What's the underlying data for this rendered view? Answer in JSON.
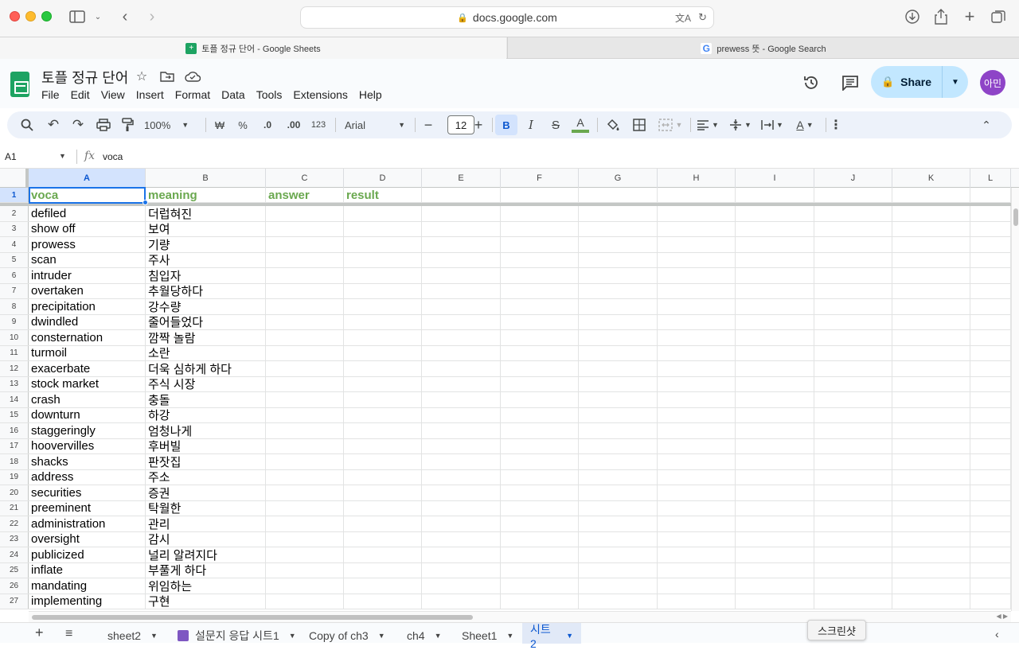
{
  "browser": {
    "url": "docs.google.com",
    "tabs": [
      {
        "title": "토플 정규 단어 - Google Sheets"
      },
      {
        "title": "prewess 뜻 - Google Search"
      }
    ]
  },
  "doc": {
    "title": "토플 정규 단어",
    "menu": [
      "File",
      "Edit",
      "View",
      "Insert",
      "Format",
      "Data",
      "Tools",
      "Extensions",
      "Help"
    ],
    "share_label": "Share",
    "avatar_text": "아민"
  },
  "toolbar": {
    "zoom": "100%",
    "currency": "₩",
    "percent": "%",
    "dec_less": ".0",
    "dec_more": ".00",
    "format_123": "123",
    "font": "Arial",
    "font_size": "12",
    "bold": "B",
    "italic": "I",
    "strike": "S",
    "text_color": "A"
  },
  "formula": {
    "cell_ref": "A1",
    "fx": "fx",
    "value": "voca"
  },
  "sheet": {
    "columns": [
      "A",
      "B",
      "C",
      "D",
      "E",
      "F",
      "G",
      "H",
      "I",
      "J",
      "K",
      "L"
    ],
    "header": [
      "voca",
      "meaning",
      "answer",
      "result"
    ],
    "rows": [
      [
        "defiled",
        "더럽혀진"
      ],
      [
        "show off",
        "보여"
      ],
      [
        "prowess",
        "기량"
      ],
      [
        "scan",
        "주사"
      ],
      [
        "intruder",
        "침입자"
      ],
      [
        "overtaken",
        "추월당하다"
      ],
      [
        "precipitation",
        "강수량"
      ],
      [
        "dwindled",
        "줄어들었다"
      ],
      [
        "consternation",
        "깜짝 놀람"
      ],
      [
        "turmoil",
        "소란"
      ],
      [
        "exacerbate",
        "더욱 심하게 하다"
      ],
      [
        "stock market",
        "주식 시장"
      ],
      [
        "crash",
        "충돌"
      ],
      [
        "downturn",
        "하강"
      ],
      [
        "staggeringly",
        "엄청나게"
      ],
      [
        "hoovervilles",
        "후버빌"
      ],
      [
        "shacks",
        "판잣집"
      ],
      [
        "address",
        "주소"
      ],
      [
        "securities",
        "증권"
      ],
      [
        "preeminent",
        "탁월한"
      ],
      [
        "administration",
        "관리"
      ],
      [
        "oversight",
        "감시"
      ],
      [
        "publicized",
        "널리 알려지다"
      ],
      [
        "inflate",
        "부풀게 하다"
      ],
      [
        "mandating",
        "위임하는"
      ],
      [
        "implementing",
        "구현"
      ]
    ]
  },
  "sheet_tabs": [
    {
      "label": "sheet2"
    },
    {
      "label": "설문지 응답 시트1"
    },
    {
      "label": "Copy of ch3"
    },
    {
      "label": "ch4"
    },
    {
      "label": "Sheet1"
    },
    {
      "label": "시트2"
    }
  ],
  "tooltip": "스크린샷",
  "colors": {
    "header_green": "#6aa84f",
    "accent_blue": "#1a73e8",
    "share_bg": "#c2e7ff"
  }
}
